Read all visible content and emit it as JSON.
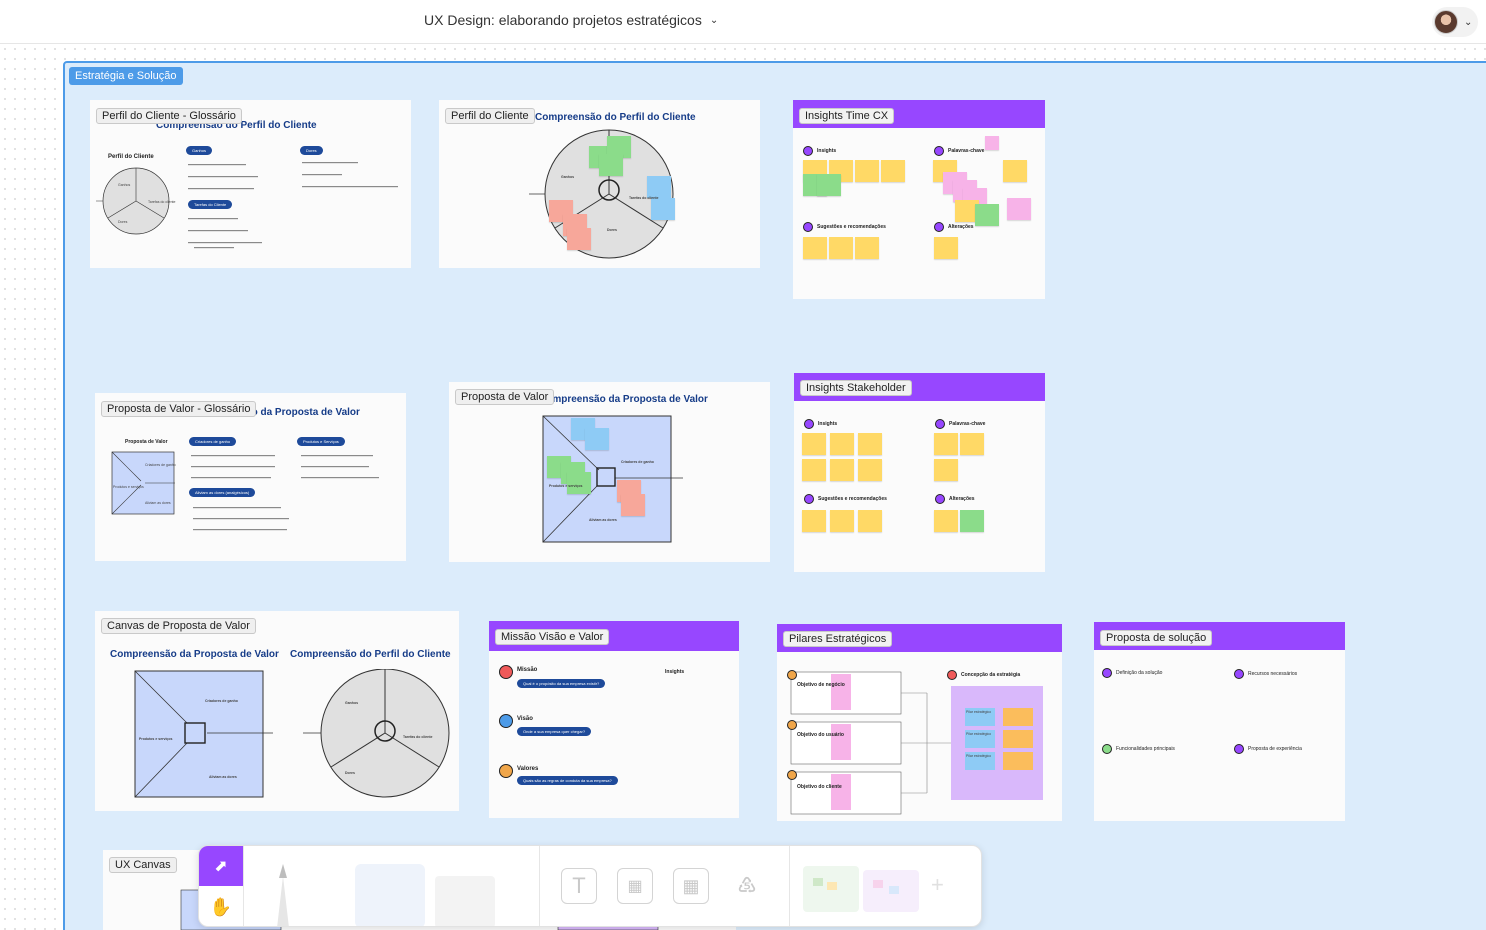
{
  "header": {
    "doc_title": "UX Design: elaborando projetos estratégicos"
  },
  "section": {
    "label": "Estratégia e Solução"
  },
  "frames": {
    "f1": {
      "label": "Perfil do Cliente - Glossário",
      "title": "Compreensão do Perfil do Cliente",
      "subtitle": "Perfil do Cliente",
      "pill_a": "Ganhos",
      "pill_b": "Dores",
      "pill_c": "Tarefas do Cliente",
      "c1": "Ganhos",
      "c2": "Tarefas do cliente",
      "c3": "Dores"
    },
    "f2": {
      "label": "Perfil do Cliente",
      "title": "Compreensão do Perfil do Cliente",
      "c1": "Ganhos",
      "c2": "Tarefas do cliente",
      "c3": "Dores"
    },
    "f3": {
      "label": "Insights Time CX",
      "h1": "Insights",
      "h2": "Palavras-chave",
      "h3": "Sugestões e recomendações",
      "h4": "Alterações"
    },
    "f4": {
      "label": "Proposta de Valor - Glossário",
      "title": "Compreensão da Proposta de Valor",
      "subtitle": "Proposta de Valor",
      "pill_a": "Criadores de ganho",
      "pill_b": "Produtos e Serviços",
      "pill_c": "Aliviam as dores (analgésicos)",
      "c1": "Criadores de ganho",
      "c2": "Produtos e serviços",
      "c3": "Aliviam as dores"
    },
    "f5": {
      "label": "Proposta de Valor",
      "title": "Compreensão da Proposta de Valor",
      "c1": "Criadores de ganho",
      "c2": "Produtos e serviços",
      "c3": "Aliviam as dores"
    },
    "f6": {
      "label": "Insights Stakeholder",
      "h1": "Insights",
      "h2": "Palavras-chave",
      "h3": "Sugestões e recomendações",
      "h4": "Alterações"
    },
    "f7": {
      "label": "Canvas de Proposta de Valor",
      "title_left": "Compreensão da Proposta de Valor",
      "title_right": "Compreensão do Perfil do Cliente",
      "l1": "Criadores de ganho",
      "l2": "Produtos e serviços",
      "l3": "Aliviam as dores",
      "r1": "Ganhos",
      "r2": "Tarefas do cliente",
      "r3": "Dores"
    },
    "f8": {
      "label": "Missão Visão e Valor",
      "m1": "Missão",
      "m1q": "Qual é o propósito da sua empresa existir?",
      "m2": "Visão",
      "m2q": "Onde a sua empresa quer chegar?",
      "m3": "Valores",
      "m3q": "Quais são as regras de conduta da sua empresa?",
      "aside": "Insights"
    },
    "f9": {
      "label": "Pilares Estratégicos",
      "o1": "Objetivo de negócio",
      "o2": "Objetivo do usuário",
      "o3": "Objetivo do cliente",
      "right": "Concepção da estratégia",
      "pv": "Pilar estratégico"
    },
    "f10": {
      "label": "Proposta de solução",
      "i1": "Definição da solução",
      "i2": "Recursos necessários",
      "i3": "Funcionalidades principais",
      "i4": "Proposta de experiência"
    },
    "f11": {
      "label": "UX Canvas"
    }
  },
  "toolbar": {
    "select_icon": "cursor-arrow-icon",
    "hand_icon": "hand-icon",
    "text_glyph": "T"
  }
}
